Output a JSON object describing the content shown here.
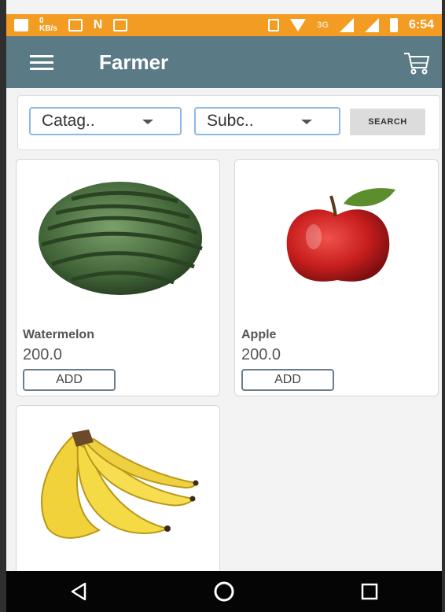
{
  "status_bar": {
    "network_label": "3G",
    "time": "6:54",
    "data_speed": "0 KB/s",
    "bg_color": "#f39c24"
  },
  "app_bar": {
    "title": "Farmer",
    "menu_icon": "menu-icon",
    "cart_icon": "cart-icon",
    "bg_color": "#5a7a86"
  },
  "filters": {
    "category_value": "Catag..",
    "subcategory_value": "Subc..",
    "search_label": "SEARCH"
  },
  "products": [
    {
      "name": "Watermelon",
      "price": "200.0",
      "add_label": "ADD",
      "image": "watermelon"
    },
    {
      "name": "Apple",
      "price": "200.0",
      "add_label": "ADD",
      "image": "apple"
    },
    {
      "name": "",
      "price": "",
      "add_label": "",
      "image": "banana"
    }
  ],
  "nav_bar": {
    "back_icon": "back-icon",
    "home_icon": "home-icon",
    "recents_icon": "recents-icon"
  }
}
